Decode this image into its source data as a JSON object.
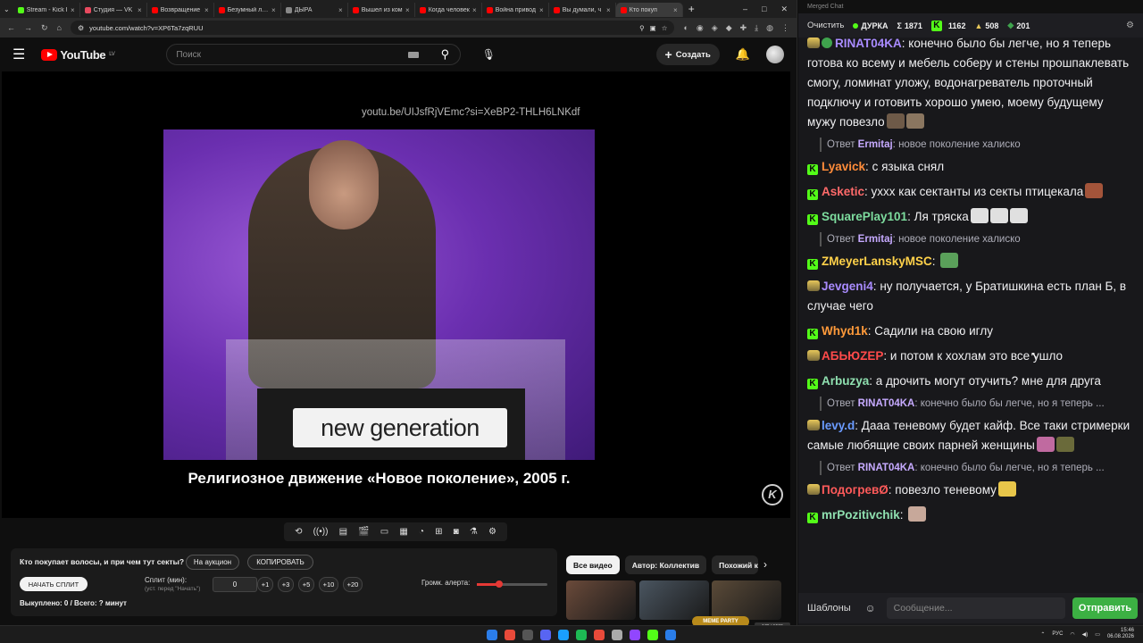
{
  "browser": {
    "tabs": [
      {
        "title": "Stream - Kick I",
        "color": "#53fc18",
        "active": false
      },
      {
        "title": "Студия — VK",
        "color": "#e84a5f",
        "active": false
      },
      {
        "title": "Возвращение",
        "color": "#ff0000",
        "active": false
      },
      {
        "title": "Безумный лор",
        "color": "#ff0000",
        "active": false
      },
      {
        "title": "ДЫРА",
        "color": "#888888",
        "active": false
      },
      {
        "title": "Вышел из ком",
        "color": "#ff0000",
        "active": false
      },
      {
        "title": "Когда человек",
        "color": "#ff0000",
        "active": false
      },
      {
        "title": "Война привод",
        "color": "#ff0000",
        "active": false
      },
      {
        "title": "Вы думали, ч",
        "color": "#ff0000",
        "active": false
      },
      {
        "title": "Кто покуп",
        "color": "#ff0000",
        "active": true
      }
    ],
    "url": "youtube.com/watch?v=XP6Ta7zqRUU",
    "window_controls": [
      "–",
      "□",
      "✕"
    ]
  },
  "youtube": {
    "logo_text": "YouTube",
    "region": "LV",
    "search_placeholder": "Поиск",
    "create_label": "Создать"
  },
  "video": {
    "link_overlay": "youtu.be/UIJsfRjVEmc?si=XeBP2-THLH6LNKdf",
    "podium_text": "new generation",
    "caption": "Религиозное движение «Новое поколение», 2005 г.",
    "watermark": "K"
  },
  "panel": {
    "question": "Кто покупает волосы, и при чем тут секты?",
    "auction_label": "На аукцион",
    "copy_label": "КОПИРОВАТЬ",
    "start_split_label": "НАЧАТЬ СПЛИТ",
    "split_label": "Сплит (мин):",
    "split_hint": "(уст. перед \"Начать\")",
    "split_value": "0",
    "increments": [
      "+1",
      "+3",
      "+5",
      "+10",
      "+20"
    ],
    "sold": "Выкуплено: 0 / Всего: ? минут",
    "alert_volume_label": "Громк. алерта:",
    "alert_volume": 0.32
  },
  "recommendations": {
    "chips": [
      "Все видео",
      "Автор: Коллектив",
      "Похожий к"
    ],
    "thumb_colors": [
      "#6a4a3a",
      "#4a5560",
      "#5a4a38"
    ],
    "meme_party": "MEME PARTY",
    "meme_count": "176 / 1500"
  },
  "chat": {
    "window_title": "Merged Chat",
    "clear_label": "Очистить",
    "streamer": "ДУРКА",
    "stats": [
      {
        "symbol": "Σ",
        "value": "1871"
      },
      {
        "symbol": "K",
        "value": "1162"
      },
      {
        "symbol": "▲",
        "value": "508"
      },
      {
        "symbol": "◆",
        "value": "201"
      }
    ],
    "templates_label": "Шаблоны",
    "input_placeholder": "Сообщение...",
    "send_label": "Отправить",
    "messages": [
      {
        "badge": "sv",
        "user": "RINAT04KA",
        "color": "#a98bff",
        "text": "конечно было бы легче, но я теперь готова ко всему и мебель соберу и стены прошпаклевать смогу, ломинат уложу, водонагреватель проточный подключу и готовить хорошо умею, моему будущему мужу повезло",
        "emotes": [
          "#6e5a48",
          "#8a7660"
        ]
      },
      {
        "reply": true,
        "to": "Ermitaj",
        "text": "новое поколение халиско"
      },
      {
        "badge": "k",
        "user": "Lyavick",
        "color": "#ff8c3a",
        "text": "с языка снял"
      },
      {
        "badge": "k",
        "user": "Asketic",
        "color": "#ff6a6a",
        "text": "ухxx как сектанты из секты птицекала",
        "emotes": [
          "#a3543a"
        ]
      },
      {
        "badge": "k",
        "user": "SquarePlay101",
        "color": "#7ddc9e",
        "text": "Ля тряска",
        "emotes": [
          "#e0e0e0",
          "#e0e0e0",
          "#e0e0e0"
        ]
      },
      {
        "reply": true,
        "to": "Ermitaj",
        "text": "новое поколение халиско"
      },
      {
        "badge": "k",
        "user": "ZMeyerLanskyMSC",
        "color": "#ffd24a",
        "text": "",
        "emotes": [
          "#5aa05a"
        ]
      },
      {
        "badge": "s",
        "user": "Jevgeni4",
        "color": "#a98bff",
        "text": "ну получается, у Братишкина есть план Б, в случае чего"
      },
      {
        "badge": "k",
        "user": "Whyd1k",
        "color": "#ff9a3a",
        "text": "Садили на свою иглу"
      },
      {
        "badge": "s",
        "user": "АБЬЮZEP",
        "color": "#ff4a4a",
        "text": "и потом к хохлам это все ушло"
      },
      {
        "badge": "k",
        "user": "Arbuzya",
        "color": "#8fe0b0",
        "text": "а дрочить могут отучить? мне для друга"
      },
      {
        "reply": true,
        "to": "RINAT04KA",
        "text": "конечно было бы легче, но я теперь ..."
      },
      {
        "badge": "s",
        "user": "levy.d",
        "color": "#6a9bff",
        "text": "Дааа теневому будет кайф. Все таки стримерки самые любящие своих парней женщины",
        "emotes": [
          "#c06aa0",
          "#6a6a3a"
        ]
      },
      {
        "reply": true,
        "to": "RINAT04KA",
        "text": "конечно было бы легче, но я теперь ..."
      },
      {
        "badge": "s",
        "user": "ПодогревØ",
        "color": "#ff5a5a",
        "text": "повезло теневому",
        "emotes": [
          "#e8c64a"
        ]
      },
      {
        "badge": "k",
        "user": "mrPozitivchik",
        "color": "#8fe0b0",
        "text": "",
        "emotes": [
          "#c7a89a"
        ]
      }
    ]
  },
  "taskbar": {
    "lang": "РУС",
    "time": "15:46",
    "date": "06.08.2026",
    "icon_colors": [
      "#2b7de9",
      "#e84a3a",
      "#555",
      "#5865f2",
      "#1a9fff",
      "#1db954",
      "#e84a3a",
      "#aaa",
      "#9146ff",
      "#53fc18",
      "#2a7de9"
    ]
  }
}
